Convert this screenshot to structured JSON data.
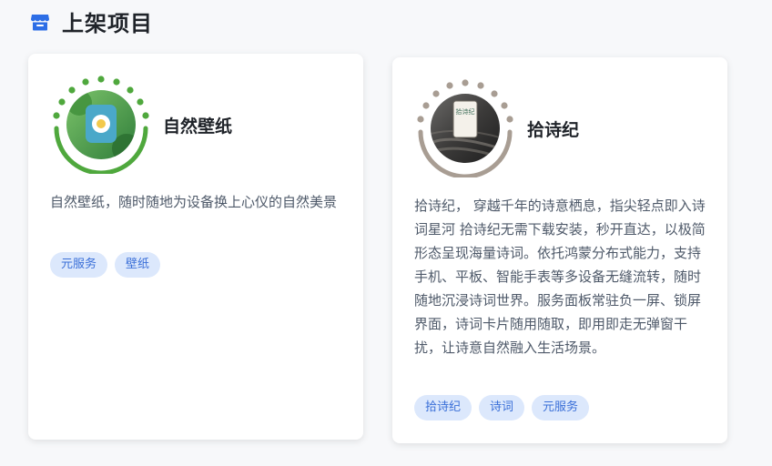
{
  "header": {
    "title": "上架项目",
    "icon": "store-icon",
    "accent": "#2d6ee6"
  },
  "projects": [
    {
      "name": "自然壁纸",
      "description": "自然壁纸，随时随地为设备换上心仪的自然美景",
      "tags": [
        "元服务",
        "壁纸"
      ],
      "ring_color": "#4fa83d",
      "icon": "nature-wallpaper-app-icon"
    },
    {
      "name": "拾诗纪",
      "description": "拾诗纪， 穿越千年的诗意栖息，指尖轻点即入诗词星河 拾诗纪无需下载安装，秒开直达，以极简形态呈现海量诗词。依托鸿蒙分布式能力，支持手机、平板、智能手表等多设备无缝流转，随时随地沉浸诗词世界。服务面板常驻负一屏、锁屏界面，诗词卡片随用随取，即用即走无弹窗干扰，让诗意自然融入生活场景。",
      "tags": [
        "拾诗纪",
        "诗词",
        "元服务"
      ],
      "ring_color": "#a89d93",
      "logo_text": "拾诗纪",
      "icon": "poetry-app-icon"
    }
  ],
  "tag_style": {
    "bg": "#dce8fc",
    "fg": "#3a6fd8"
  }
}
